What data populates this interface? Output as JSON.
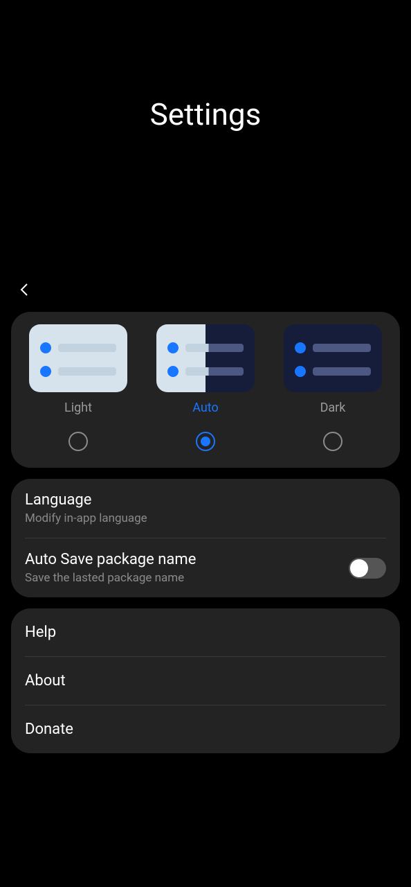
{
  "header": {
    "title": "Settings"
  },
  "theme": {
    "options": [
      {
        "label": "Light",
        "selected": false
      },
      {
        "label": "Auto",
        "selected": true
      },
      {
        "label": "Dark",
        "selected": false
      }
    ]
  },
  "settings": {
    "language": {
      "title": "Language",
      "subtitle": "Modify in-app language"
    },
    "autosave": {
      "title": "Auto Save package name",
      "subtitle": "Save the lasted package name",
      "enabled": false
    }
  },
  "links": {
    "help": "Help",
    "about": "About",
    "donate": "Donate"
  }
}
